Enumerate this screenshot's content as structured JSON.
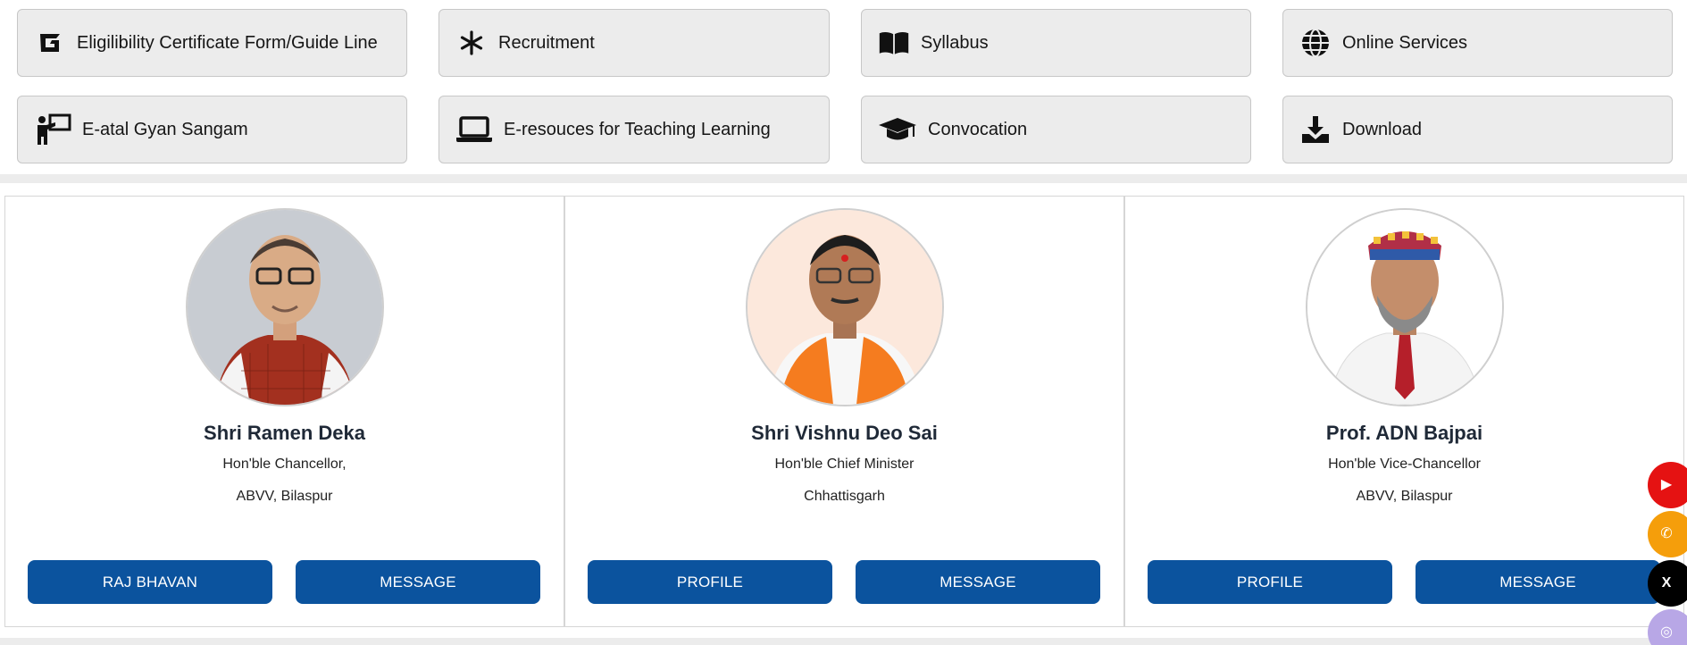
{
  "quick_links": {
    "row1": [
      {
        "label": "Eligilibility Certificate Form/Guide Line",
        "icon": "g-logo-icon"
      },
      {
        "label": "Recruitment",
        "icon": "asterisk-icon"
      },
      {
        "label": "Syllabus",
        "icon": "book-icon"
      },
      {
        "label": "Online Services",
        "icon": "globe-icon"
      }
    ],
    "row2": [
      {
        "label": "E-atal Gyan Sangam",
        "icon": "teacher-board-icon"
      },
      {
        "label": "E-resouces for Teaching Learning",
        "icon": "laptop-icon"
      },
      {
        "label": "Convocation",
        "icon": "graduation-cap-icon"
      },
      {
        "label": "Download",
        "icon": "download-icon"
      }
    ]
  },
  "profiles": [
    {
      "name": "Shri Ramen Deka",
      "role_line1": "Hon'ble Chancellor,",
      "role_line2": "ABVV, Bilaspur",
      "buttons": [
        "RAJ BHAVAN",
        "MESSAGE"
      ]
    },
    {
      "name": "Shri Vishnu Deo Sai",
      "role_line1": "Hon'ble Chief Minister",
      "role_line2": "Chhattisgarh",
      "buttons": [
        "PROFILE",
        "MESSAGE"
      ]
    },
    {
      "name": "Prof. ADN Bajpai",
      "role_line1": "Hon'ble Vice-Chancellor",
      "role_line2": "ABVV, Bilaspur",
      "buttons": [
        "PROFILE",
        "MESSAGE"
      ]
    }
  ],
  "social": {
    "items": [
      {
        "name": "youtube",
        "glyph": "▶",
        "color": "#e51212"
      },
      {
        "name": "whatsapp",
        "glyph": "✆",
        "color": "#f59e0b"
      },
      {
        "name": "x",
        "glyph": "X",
        "color": "#000000"
      },
      {
        "name": "instagram",
        "glyph": "◎",
        "color": "#b8a7e6"
      }
    ]
  },
  "colors": {
    "button_blue": "#0b539e",
    "tile_bg": "#ececec"
  }
}
